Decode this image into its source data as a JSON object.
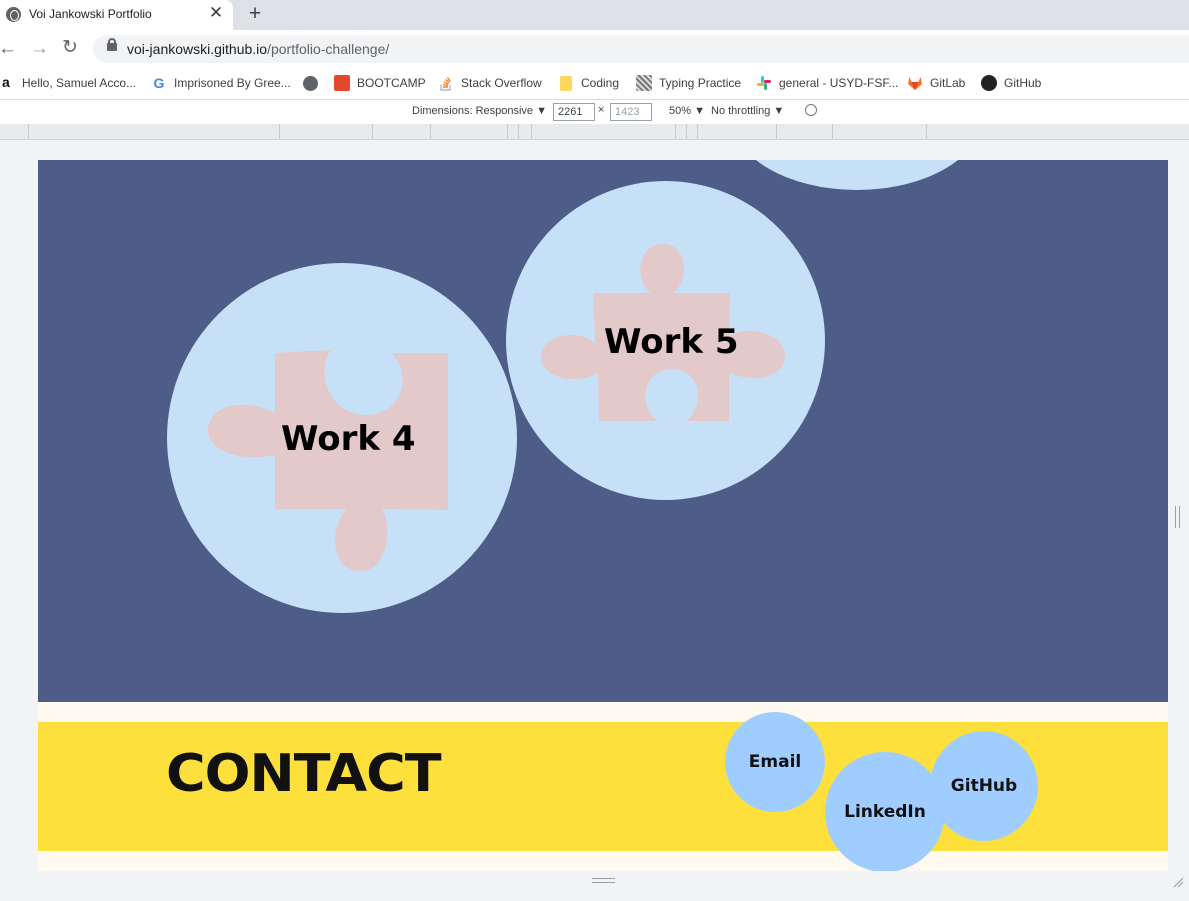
{
  "browser": {
    "tab_title": "Voi Jankowski Portfolio",
    "tab_close": "✕",
    "new_tab": "+",
    "url_host": "voi-jankowski.github.io",
    "url_path": "/portfolio-challenge/",
    "nav": {
      "back": "←",
      "forward": "→",
      "reload": "↻"
    }
  },
  "bookmarks": [
    {
      "label": "Hello, Samuel Acco...",
      "icon": "amazon-icon"
    },
    {
      "label": "Imprisoned By Gree...",
      "icon": "google-icon"
    },
    {
      "label": "",
      "icon": "globe-icon"
    },
    {
      "label": "BOOTCAMP",
      "icon": "bootcamp-icon"
    },
    {
      "label": "Stack Overflow",
      "icon": "stackoverflow-icon"
    },
    {
      "label": "Coding",
      "icon": "folder-icon"
    },
    {
      "label": "Typing Practice",
      "icon": "typing-icon"
    },
    {
      "label": "general - USYD-FSF...",
      "icon": "slack-icon"
    },
    {
      "label": "GitLab",
      "icon": "gitlab-icon"
    },
    {
      "label": "GitHub",
      "icon": "github-icon"
    }
  ],
  "devtools": {
    "dimensions_label": "Dimensions: Responsive ▼",
    "width_value": "2261",
    "times": "×",
    "height_placeholder": "1423",
    "zoom": "50% ▼",
    "throttling": "No throttling ▼"
  },
  "page": {
    "works": [
      {
        "label": "Work 4"
      },
      {
        "label": "Work 5"
      }
    ],
    "contact_title": "CONTACT",
    "contact_links": [
      {
        "label": "Email"
      },
      {
        "label": "LinkedIn"
      },
      {
        "label": "GitHub"
      }
    ]
  },
  "colors": {
    "work_bg": "#4e5d87",
    "circle": "#c6e0f8",
    "puzzle": "#e3c9c9",
    "contact_band": "#fde03b",
    "bubble": "#9fcdff",
    "page_bg": "#fff9f0"
  }
}
